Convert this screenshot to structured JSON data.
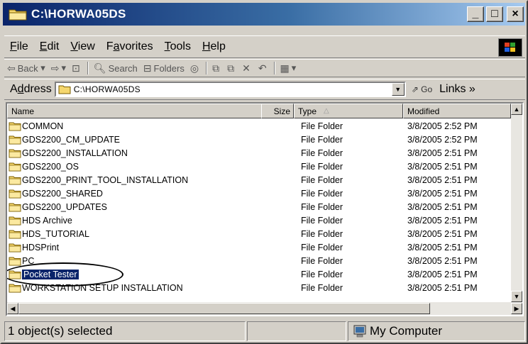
{
  "window": {
    "title": "C:\\HORWA05DS",
    "minimize": "_",
    "maximize": "□",
    "close": "×"
  },
  "menu": [
    "File",
    "Edit",
    "View",
    "Favorites",
    "Tools",
    "Help"
  ],
  "menu_accel": [
    "F",
    "E",
    "V",
    "a",
    "T",
    "H"
  ],
  "toolbar": {
    "back": "Back",
    "search": "Search",
    "folders": "Folders"
  },
  "address": {
    "label": "Address",
    "value": "C:\\HORWA05DS",
    "go": "Go",
    "links": "Links"
  },
  "columns": {
    "name": "Name",
    "size": "Size",
    "type": "Type",
    "modified": "Modified"
  },
  "files": [
    {
      "name": "COMMON",
      "type": "File Folder",
      "modified": "3/8/2005 2:52 PM"
    },
    {
      "name": "GDS2200_CM_UPDATE",
      "type": "File Folder",
      "modified": "3/8/2005 2:52 PM"
    },
    {
      "name": "GDS2200_INSTALLATION",
      "type": "File Folder",
      "modified": "3/8/2005 2:51 PM"
    },
    {
      "name": "GDS2200_OS",
      "type": "File Folder",
      "modified": "3/8/2005 2:51 PM"
    },
    {
      "name": "GDS2200_PRINT_TOOL_INSTALLATION",
      "type": "File Folder",
      "modified": "3/8/2005 2:51 PM"
    },
    {
      "name": "GDS2200_SHARED",
      "type": "File Folder",
      "modified": "3/8/2005 2:51 PM"
    },
    {
      "name": "GDS2200_UPDATES",
      "type": "File Folder",
      "modified": "3/8/2005 2:51 PM"
    },
    {
      "name": "HDS Archive",
      "type": "File Folder",
      "modified": "3/8/2005 2:51 PM"
    },
    {
      "name": "HDS_TUTORIAL",
      "type": "File Folder",
      "modified": "3/8/2005 2:51 PM"
    },
    {
      "name": "HDSPrint",
      "type": "File Folder",
      "modified": "3/8/2005 2:51 PM"
    },
    {
      "name": "PC",
      "type": "File Folder",
      "modified": "3/8/2005 2:51 PM"
    },
    {
      "name": "Pocket Tester",
      "type": "File Folder",
      "modified": "3/8/2005 2:51 PM",
      "selected": true
    },
    {
      "name": "WORKSTATION SETUP INSTALLATION",
      "type": "File Folder",
      "modified": "3/8/2005 2:51 PM"
    }
  ],
  "status": {
    "selection": "1 object(s) selected",
    "zone": "My Computer"
  },
  "colors": {
    "title_start": "#0a246a",
    "title_end": "#a6caf0",
    "selection": "#0a246a",
    "folder": "#f5d76e"
  }
}
